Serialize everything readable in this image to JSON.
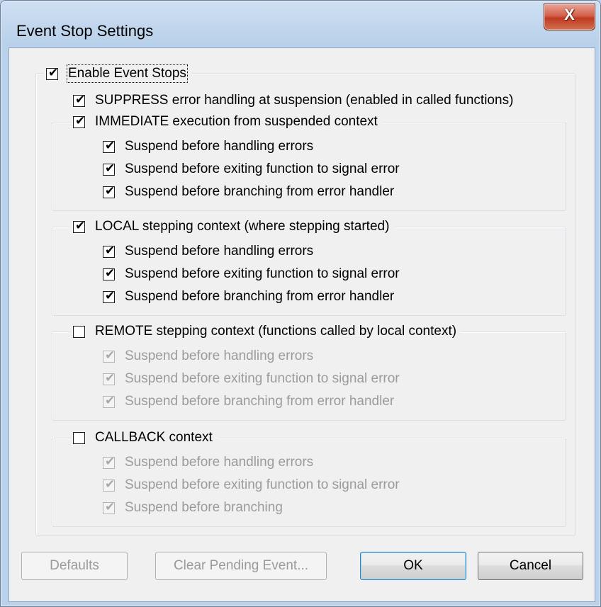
{
  "window": {
    "title": "Event Stop Settings",
    "close_glyph": "X"
  },
  "enable": {
    "label": "Enable Event Stops",
    "checked": true
  },
  "suppress": {
    "label": "SUPPRESS error handling at suspension (enabled in called functions)",
    "checked": true
  },
  "immediate": {
    "label": "IMMEDIATE execution from suspended context",
    "checked": true,
    "items": [
      {
        "label": "Suspend before handling errors",
        "checked": true
      },
      {
        "label": "Suspend before exiting function to signal error",
        "checked": true
      },
      {
        "label": "Suspend before branching from error handler",
        "checked": true
      }
    ]
  },
  "local": {
    "label": "LOCAL stepping context (where stepping started)",
    "checked": true,
    "items": [
      {
        "label": "Suspend before handling errors",
        "checked": true
      },
      {
        "label": "Suspend before exiting function to signal error",
        "checked": true
      },
      {
        "label": "Suspend before branching from error handler",
        "checked": true
      }
    ]
  },
  "remote": {
    "label": "REMOTE stepping context (functions called by local context)",
    "checked": false,
    "items": [
      {
        "label": "Suspend before handling errors",
        "checked": true
      },
      {
        "label": "Suspend before exiting function to signal error",
        "checked": true
      },
      {
        "label": "Suspend before branching from error handler",
        "checked": true
      }
    ]
  },
  "callback": {
    "label": "CALLBACK context",
    "checked": false,
    "items": [
      {
        "label": "Suspend before handling errors",
        "checked": true
      },
      {
        "label": "Suspend before exiting function to signal error",
        "checked": true
      },
      {
        "label": "Suspend before branching",
        "checked": true
      }
    ]
  },
  "buttons": {
    "defaults": "Defaults",
    "clear_pending": "Clear Pending Event...",
    "ok": "OK",
    "cancel": "Cancel"
  },
  "check_glyph": "✔"
}
